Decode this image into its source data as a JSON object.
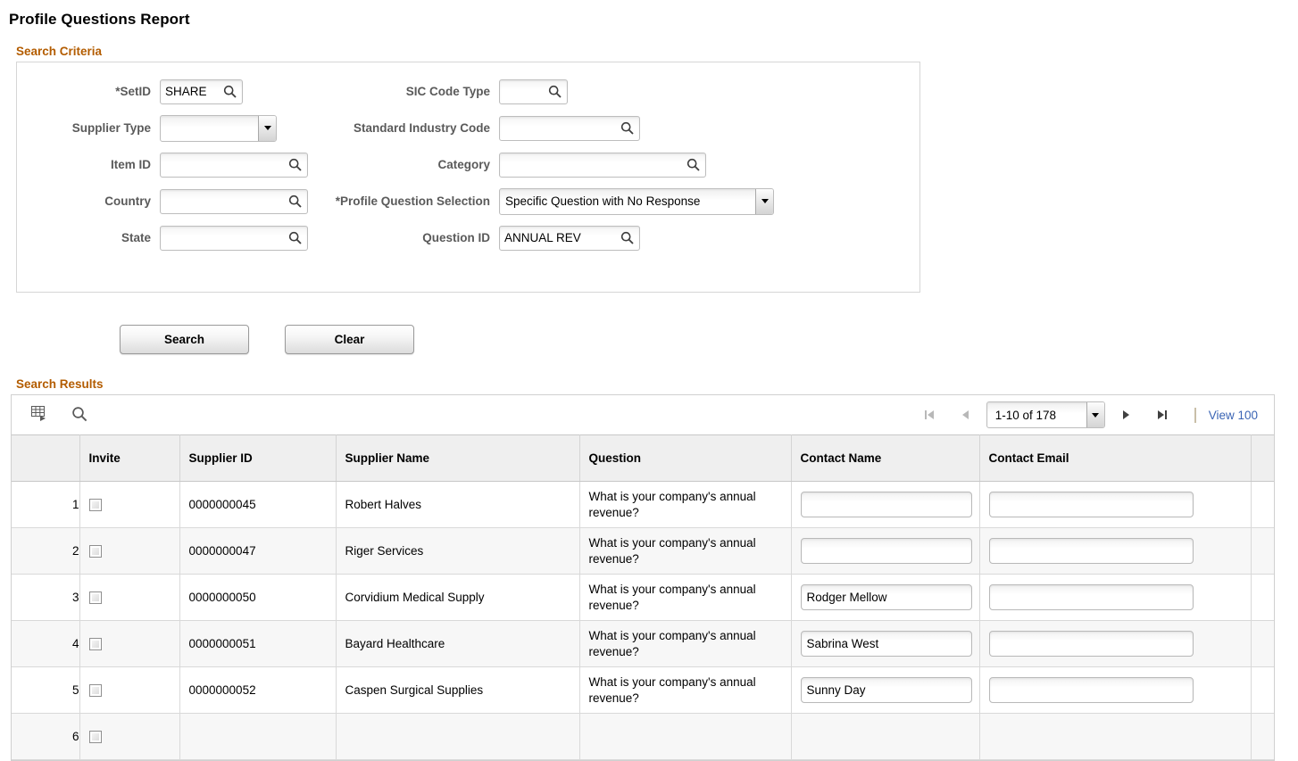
{
  "page": {
    "title": "Profile Questions Report"
  },
  "search_criteria": {
    "legend": "Search Criteria",
    "left_fields": [
      {
        "label": "*SetID",
        "required": true,
        "type": "lookup",
        "value": "SHARE",
        "size": "w-sm",
        "icon": "search-icon"
      },
      {
        "label": "Supplier Type",
        "required": false,
        "type": "select",
        "value": "",
        "size": "sel-supplier-type",
        "icon": "chevron-down-icon"
      },
      {
        "label": "Item ID",
        "required": false,
        "type": "lookup",
        "value": "",
        "size": "w-lg",
        "icon": "search-icon"
      },
      {
        "label": "Country",
        "required": false,
        "type": "lookup",
        "value": "",
        "size": "w-lg",
        "icon": "search-icon"
      },
      {
        "label": "State",
        "required": false,
        "type": "lookup",
        "value": "",
        "size": "w-lg",
        "icon": "search-icon"
      }
    ],
    "right_fields": [
      {
        "label": "SIC Code Type",
        "required": false,
        "type": "lookup",
        "value": "",
        "size": "w-sic",
        "icon": "search-icon"
      },
      {
        "label": "Standard Industry Code",
        "required": false,
        "type": "lookup",
        "value": "",
        "size": "w-std",
        "icon": "search-icon"
      },
      {
        "label": "Category",
        "required": false,
        "type": "lookup",
        "value": "",
        "size": "w-cat",
        "icon": "search-icon"
      },
      {
        "label": "*Profile Question Selection",
        "required": true,
        "type": "select",
        "value": "Specific Question with No Response",
        "size": "sel-pqs",
        "icon": "chevron-down-icon"
      },
      {
        "label": "Question ID",
        "required": false,
        "type": "lookup",
        "value": "ANNUAL REV",
        "size": "w-xl",
        "icon": "search-icon"
      }
    ]
  },
  "buttons": {
    "search_label": "Search",
    "clear_label": "Clear"
  },
  "search_results": {
    "legend": "Search Results",
    "toolbar": {
      "grid_icon": "download-to-spreadsheet-icon",
      "find_icon": "find-icon",
      "first_icon": "first-page-icon",
      "prev_icon": "previous-page-icon",
      "next_icon": "next-page-icon",
      "last_icon": "last-page-icon",
      "range_value": "1-10 of 178",
      "view_all_label": "View 100"
    },
    "columns": [
      "",
      "Invite",
      "Supplier ID",
      "Supplier Name",
      "Question",
      "Contact Name",
      "Contact Email",
      ""
    ],
    "rows": [
      {
        "num": "1",
        "invite_checked": false,
        "supplier_id": "0000000045",
        "supplier_name": "Robert Halves",
        "question": "What is your company's annual revenue?",
        "contact_name": "",
        "contact_email": ""
      },
      {
        "num": "2",
        "invite_checked": false,
        "supplier_id": "0000000047",
        "supplier_name": "Riger Services",
        "question": "What is your company's annual revenue?",
        "contact_name": "",
        "contact_email": ""
      },
      {
        "num": "3",
        "invite_checked": false,
        "supplier_id": "0000000050",
        "supplier_name": "Corvidium Medical Supply",
        "question": "What is your company's annual revenue?",
        "contact_name": "Rodger Mellow",
        "contact_email": ""
      },
      {
        "num": "4",
        "invite_checked": false,
        "supplier_id": "0000000051",
        "supplier_name": "Bayard Healthcare",
        "question": "What is your company's annual revenue?",
        "contact_name": "Sabrina West",
        "contact_email": ""
      },
      {
        "num": "5",
        "invite_checked": false,
        "supplier_id": "0000000052",
        "supplier_name": "Caspen Surgical Supplies",
        "question": "What is your company's annual revenue?",
        "contact_name": "Sunny Day",
        "contact_email": ""
      },
      {
        "num": "6",
        "invite_checked": false,
        "supplier_id": "",
        "supplier_name": "",
        "question": "",
        "contact_name": "",
        "contact_email": ""
      }
    ]
  },
  "colors": {
    "group_label": "#b35c00",
    "link": "#3a64b4",
    "header_bg": "#efefef",
    "alt_row_bg": "#f7f7f7"
  }
}
